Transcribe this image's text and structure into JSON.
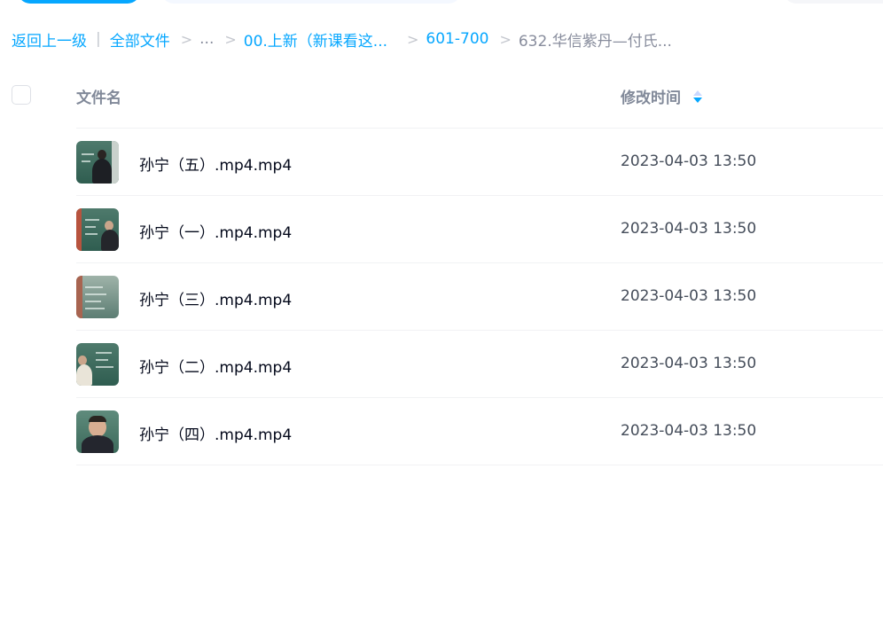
{
  "breadcrumb": {
    "back": "返回上一级",
    "separator": "|",
    "arrow": ">",
    "all_files": "全部文件",
    "ellipsis": "...",
    "folder1": "00.上新（新课看这...",
    "folder2": "601-700",
    "current": "632.华信紫丹—付氏..."
  },
  "header": {
    "name": "文件名",
    "time": "修改时间"
  },
  "files": [
    {
      "name": "孙宁（五）.mp4.mp4",
      "time": "2023-04-03 13:50"
    },
    {
      "name": "孙宁（一）.mp4.mp4",
      "time": "2023-04-03 13:50"
    },
    {
      "name": "孙宁（三）.mp4.mp4",
      "time": "2023-04-03 13:50"
    },
    {
      "name": "孙宁（二）.mp4.mp4",
      "time": "2023-04-03 13:50"
    },
    {
      "name": "孙宁（四）.mp4.mp4",
      "time": "2023-04-03 13:50"
    }
  ],
  "colors": {
    "accent": "#06a7ff",
    "muted": "#878c9c",
    "text": "#03081a",
    "time_text": "#454d5a"
  },
  "icons": {
    "sort": "sort-arrows-icon",
    "thumbnail": "video-thumbnail"
  }
}
